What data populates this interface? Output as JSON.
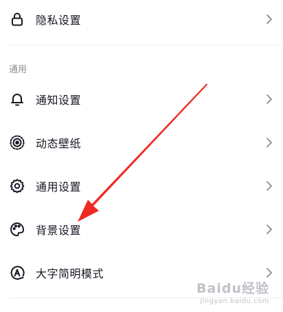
{
  "top_item": {
    "label": "隐私设置",
    "icon": "lock-icon"
  },
  "section": {
    "title": "通用",
    "items": [
      {
        "label": "通知设置",
        "icon": "bell-icon"
      },
      {
        "label": "动态壁纸",
        "icon": "live-wallpaper-icon"
      },
      {
        "label": "通用设置",
        "icon": "gear-icon"
      },
      {
        "label": "背景设置",
        "icon": "palette-icon"
      },
      {
        "label": "大字简明模式",
        "icon": "font-size-icon"
      }
    ]
  },
  "annotation": {
    "arrow_color": "#ee2a24",
    "target": "背景设置"
  },
  "watermark": {
    "brand": "Baidu经验",
    "url": "jingyan.baidu.com"
  }
}
